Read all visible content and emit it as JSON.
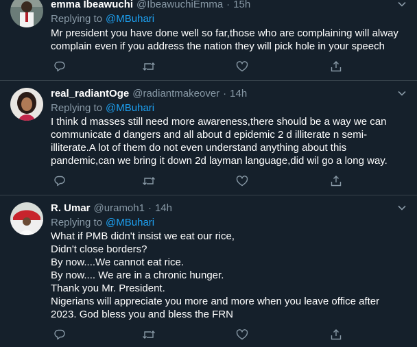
{
  "tweets": [
    {
      "name": "emma Ibeawuchi",
      "handle": "@IbeawuchiEmma",
      "time": "15h",
      "replying_label": "Replying to",
      "replying_to": "@MBuhari",
      "lines": [
        "Mr president you have done well so far,those who are complaining will alway",
        "complain even if you address the nation they will pick hole in your speech"
      ]
    },
    {
      "name": "real_radiantOge",
      "handle": "@radiantmakeover",
      "time": "14h",
      "replying_label": "Replying to",
      "replying_to": "@MBuhari",
      "lines": [
        "I think d masses still need more awareness,there should be a way we can",
        "communicate d dangers and all about d epidemic 2 d illiterate n semi-",
        "illiterate.A lot of them do not even understand anything about this",
        "pandemic,can we bring it down 2d layman language,did wil go a long way."
      ]
    },
    {
      "name": "R. Umar",
      "handle": "@uramoh1",
      "time": "14h",
      "replying_label": "Replying to",
      "replying_to": "@MBuhari",
      "lines": [
        "What if PMB didn't insist we eat our rice,",
        "Didn't close borders?",
        "By now....We cannot eat rice.",
        "By now.... We are in a chronic hunger.",
        "Thank you Mr. President.",
        "Nigerians will appreciate you more and more when you leave office after",
        "2023. God bless you and bless the FRN"
      ]
    }
  ],
  "icons": [
    "reply-icon",
    "retweet-icon",
    "like-icon",
    "share-icon",
    "chevron-down-icon"
  ],
  "colors": {
    "background": "#15202b",
    "divider": "#38444d",
    "secondary_text": "#8899a6",
    "link": "#1da1f2",
    "primary_text": "#ffffff"
  }
}
